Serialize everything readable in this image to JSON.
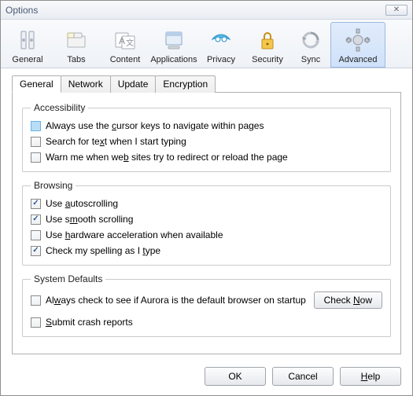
{
  "window": {
    "title": "Options"
  },
  "toolbar": {
    "items": [
      {
        "label": "General"
      },
      {
        "label": "Tabs"
      },
      {
        "label": "Content"
      },
      {
        "label": "Applications"
      },
      {
        "label": "Privacy"
      },
      {
        "label": "Security"
      },
      {
        "label": "Sync"
      },
      {
        "label": "Advanced"
      }
    ]
  },
  "subtabs": {
    "items": [
      {
        "label": "General"
      },
      {
        "label": "Network"
      },
      {
        "label": "Update"
      },
      {
        "label": "Encryption"
      }
    ]
  },
  "groups": {
    "accessibility": {
      "legend": "Accessibility",
      "items": [
        {
          "text": "Always use the cursor keys to navigate within pages",
          "checked": false,
          "highlight": true,
          "accel": "c"
        },
        {
          "text": "Search for text when I start typing",
          "checked": false,
          "accel": "x"
        },
        {
          "text": "Warn me when web sites try to redirect or reload the page",
          "checked": false,
          "accel": "b"
        }
      ]
    },
    "browsing": {
      "legend": "Browsing",
      "items": [
        {
          "text": "Use autoscrolling",
          "checked": true,
          "accel": "a"
        },
        {
          "text": "Use smooth scrolling",
          "checked": true,
          "accel": "m"
        },
        {
          "text": "Use hardware acceleration when available",
          "checked": false,
          "accel": "h"
        },
        {
          "text": "Check my spelling as I type",
          "checked": true,
          "accel": "t"
        }
      ]
    },
    "defaults": {
      "legend": "System Defaults",
      "row": {
        "text": "Always check to see if Aurora is the default browser on startup",
        "checked": false,
        "accel": "w",
        "button": "Check Now",
        "baccel": "N"
      },
      "submit": {
        "text": "Submit crash reports",
        "checked": false,
        "accel": "S"
      }
    }
  },
  "footer": {
    "ok": "OK",
    "cancel": "Cancel",
    "help": "Help"
  }
}
